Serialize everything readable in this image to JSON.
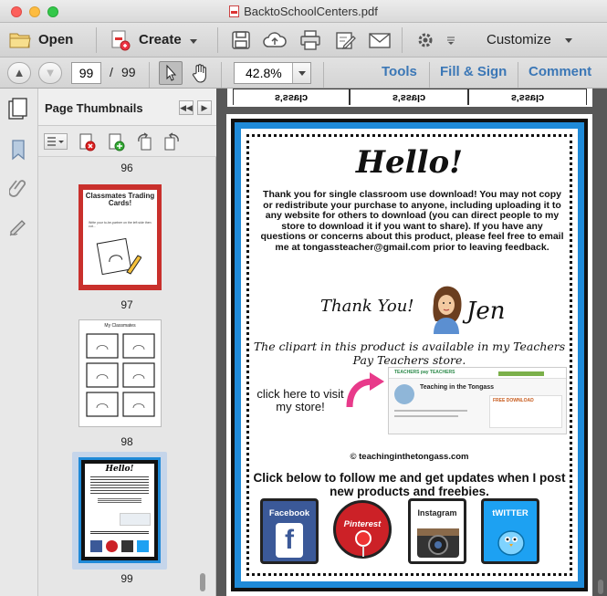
{
  "window": {
    "title": "BacktoSchoolCenters.pdf"
  },
  "toolbar": {
    "open_label": "Open",
    "create_label": "Create",
    "customize_label": "Customize"
  },
  "nav": {
    "current_page": "99",
    "page_separator": "/",
    "total_pages": "99",
    "zoom": "42.8%",
    "tools_label": "Tools",
    "fill_sign_label": "Fill & Sign",
    "comment_label": "Comment"
  },
  "sidebar": {
    "panel_title": "Page Thumbnails",
    "thumbnails": [
      {
        "page": "96"
      },
      {
        "page": "97",
        "title": "Classmates Trading Cards!",
        "text": "Write your to-be-partner on the left side then cut..."
      },
      {
        "page": "98",
        "title": "My Classmates"
      },
      {
        "page": "99",
        "title": "Hello!"
      }
    ]
  },
  "document": {
    "prev_page_cells": [
      "s'ssɐlɔ",
      "s'ssɐlɔ",
      "s'ssɐlɔ"
    ],
    "greeting": "Hello!",
    "paragraph": "Thank you for single classroom use download! You may not copy or redistribute your purchase to anyone, including uploading it to any website for others to download (you can direct people to my store to download it if you want to share). If you have any questions or concerns about this product, please feel free to email me at tongassteacher@gmail.com prior to leaving feedback.",
    "thanks": "Thank You!",
    "signature": "Jen",
    "clipart_note": "The clipart in this product is available in my Teachers Pay Teachers store.",
    "click_here": "click here to visit my store!",
    "store_name": "Teaching in the Tongass",
    "store_logo": "TEACHERS pay TEACHERS",
    "store_free": "FREE DOWNLOAD",
    "website": "© teachinginthetongass.com",
    "follow_text": "Click below to follow me and get updates when I post new products and freebies.",
    "social": [
      "Facebook",
      "Pinterest",
      "Instagram",
      "tWITTER"
    ]
  },
  "colors": {
    "accent_blue": "#3b77b6",
    "frame_blue": "#1f8ad8",
    "pink_arrow": "#e83a8a",
    "facebook": "#3b5998",
    "pinterest": "#cc2127",
    "twitter": "#1da1f2"
  }
}
